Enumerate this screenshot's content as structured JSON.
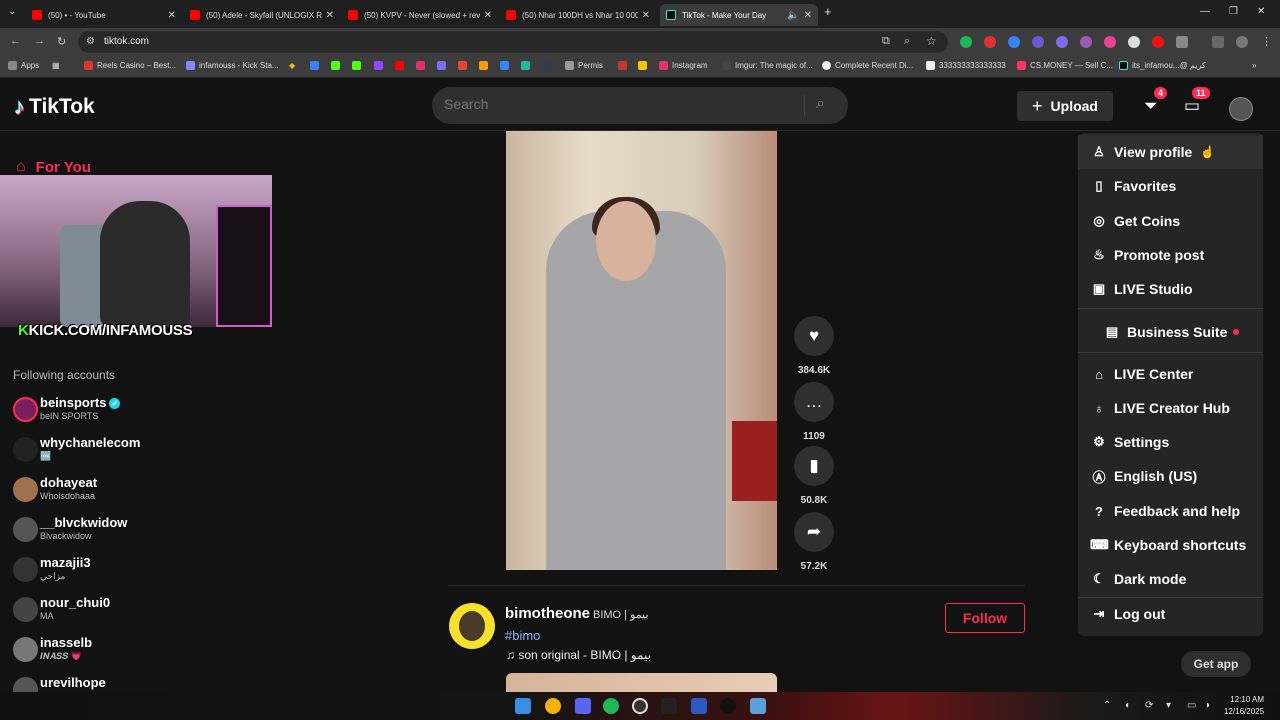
{
  "browser": {
    "tabs": [
      {
        "title": "(50) • - YouTube",
        "color": "#ff0000"
      },
      {
        "title": "(50) Adele - Skyfall (UNLOGIX Re",
        "color": "#ff0000"
      },
      {
        "title": "(50) KVPV - Never (slowed + rev",
        "color": "#ff0000"
      },
      {
        "title": "(50) Nhar 100DH vs Nhar 10 000",
        "color": "#ff0000"
      },
      {
        "title": "TikTok - Make Your Day",
        "color": "#000000"
      }
    ],
    "new_tab": "+",
    "url": "tiktok.com",
    "bookmarks": [
      {
        "label": "Apps",
        "color": "#888888"
      },
      {
        "label": "Reels Casino – Best...",
        "color": "#d33"
      },
      {
        "label": "infamouss - Kick Sta...",
        "color": "#7a8aff"
      },
      {
        "label": "Permis",
        "color": "#999999"
      },
      {
        "label": "Instagram",
        "color": "#e1306c"
      },
      {
        "label": "Imgur: The magic of...",
        "color": "#444444"
      },
      {
        "label": "Complete Recent Di...",
        "color": "#eeeeee"
      },
      {
        "label": "333333333333333",
        "color": "#eeeeee"
      },
      {
        "label": "CS.MONEY — Sell C...",
        "color": "#ff3366"
      },
      {
        "label": "its_infamou...@ كريم",
        "color": "#000000"
      }
    ]
  },
  "header": {
    "logo": "TikTok",
    "search_placeholder": "Search",
    "upload_label": "Upload",
    "inbox_badge": "4",
    "messages_badge": "11"
  },
  "sidebar": {
    "for_you": "For You",
    "stream_overlay": "KICK.COM/INFAMOUSS",
    "following_title": "Following accounts",
    "accounts": [
      {
        "name": "beinsports",
        "sub": "beIN SPORTS",
        "verified": true,
        "color": "#7a1f5c"
      },
      {
        "name": "whychanelecom",
        "sub": "🆒",
        "verified": false,
        "color": "#222222"
      },
      {
        "name": "dohayeat",
        "sub": "Whoisdohaaa",
        "verified": false,
        "color": "#a07050"
      },
      {
        "name": "__blvckwidow",
        "sub": "Blvackwidow",
        "verified": false,
        "color": "#555555"
      },
      {
        "name": "mazajii3",
        "sub": "مزاجي",
        "verified": false,
        "color": "#333333"
      },
      {
        "name": "nour_chui0",
        "sub": "MA",
        "verified": false,
        "color": "#444444"
      },
      {
        "name": "inasselb",
        "sub": "𝑰𝑵𝑨𝑺𝑺 💗",
        "verified": false,
        "color": "#777777"
      },
      {
        "name": "urevilhope",
        "sub": "",
        "verified": false,
        "color": "#555555"
      }
    ]
  },
  "video": {
    "likes": "384.6K",
    "comments": "1109",
    "saves": "50.8K",
    "shares": "57.2K"
  },
  "post": {
    "username": "bimotheone",
    "display_name": "BIMO | بيمو",
    "hashtag": "#bimo",
    "music": "♫ son original - BIMO | بيمو",
    "follow_label": "Follow"
  },
  "menu": {
    "items": [
      {
        "label": "View profile",
        "icon": "person-icon"
      },
      {
        "label": "Favorites",
        "icon": "bookmark-icon"
      },
      {
        "label": "Get Coins",
        "icon": "coin-icon"
      },
      {
        "label": "Promote post",
        "icon": "flame-icon"
      },
      {
        "label": "LIVE Studio",
        "icon": "video-icon"
      },
      {
        "label": "Business Suite",
        "icon": "business-icon"
      },
      {
        "label": "LIVE Center",
        "icon": "home-icon"
      },
      {
        "label": "LIVE Creator Hub",
        "icon": "bulb-icon"
      },
      {
        "label": "Settings",
        "icon": "gear-icon"
      },
      {
        "label": "English (US)",
        "icon": "language-icon"
      },
      {
        "label": "Feedback and help",
        "icon": "help-icon"
      },
      {
        "label": "Keyboard shortcuts",
        "icon": "keyboard-icon"
      },
      {
        "label": "Dark mode",
        "icon": "moon-icon"
      },
      {
        "label": "Log out",
        "icon": "logout-icon"
      }
    ],
    "get_app": "Get app"
  },
  "taskbar": {
    "time": "12:10 AM",
    "date": "12/16/2025"
  },
  "colors": {
    "accent": "#fe2c55",
    "background": "#121212",
    "panel": "#252525"
  }
}
